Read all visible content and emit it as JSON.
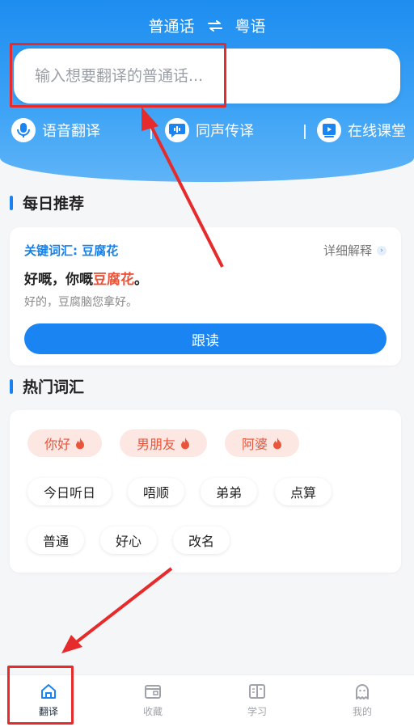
{
  "header": {
    "source_lang": "普通话",
    "target_lang": "粤语",
    "input_placeholder": "输入想要翻译的普通话..."
  },
  "features": [
    {
      "label": "语音翻译",
      "icon": "voice-translate-icon"
    },
    {
      "label": "同声传译",
      "icon": "simultaneous-interpretation-icon"
    },
    {
      "label": "在线课堂",
      "icon": "online-class-icon"
    }
  ],
  "daily": {
    "title": "每日推荐",
    "keyword": "关键词汇: 豆腐花",
    "detail_label": "详细解释",
    "sentence_prefix": "好嘅，你嘅",
    "sentence_highlight": "豆腐花",
    "sentence_suffix": "。",
    "meaning": "好的，豆腐脑您拿好。",
    "follow_label": "跟读"
  },
  "hot": {
    "title": "热门词汇",
    "hot_tags": [
      "你好",
      "男朋友",
      "阿婆"
    ],
    "tags_row2": [
      "今日听日",
      "唔顺",
      "弟弟",
      "点算"
    ],
    "tags_row3": [
      "普通",
      "好心",
      "改名"
    ]
  },
  "nav": [
    {
      "label": "翻译",
      "icon": "home-icon",
      "active": true
    },
    {
      "label": "收藏",
      "icon": "wallet-icon",
      "active": false
    },
    {
      "label": "学习",
      "icon": "book-icon",
      "active": false
    },
    {
      "label": "我的",
      "icon": "ghost-icon",
      "active": false
    }
  ],
  "colors": {
    "primary": "#1a85f2",
    "hot": "#e8553a",
    "annotation": "#e52b2b"
  }
}
